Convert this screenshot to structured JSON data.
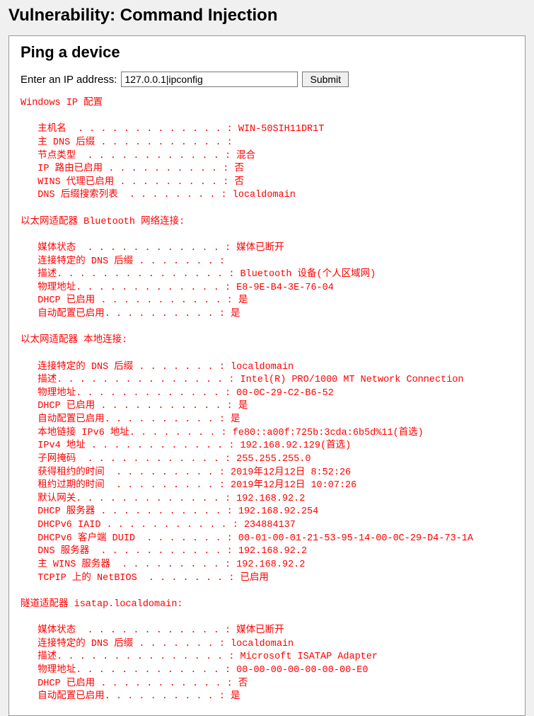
{
  "page": {
    "title": "Vulnerability: Command Injection"
  },
  "panel": {
    "title": "Ping a device",
    "form": {
      "label": "Enter an IP address:",
      "input_value": "127.0.0.1|ipconfig",
      "submit_label": "Submit"
    }
  },
  "output_text": "Windows IP 配置\n\n   主机名  . . . . . . . . . . . . . : WIN-50SIH11DR1T\n   主 DNS 后缀 . . . . . . . . . . . : \n   节点类型  . . . . . . . . . . . . : 混合\n   IP 路由已启用 . . . . . . . . . . : 否\n   WINS 代理已启用 . . . . . . . . . : 否\n   DNS 后缀搜索列表  . . . . . . . . : localdomain\n\n以太网适配器 Bluetooth 网络连接:\n\n   媒体状态  . . . . . . . . . . . . : 媒体已断开\n   连接特定的 DNS 后缀 . . . . . . . : \n   描述. . . . . . . . . . . . . . . : Bluetooth 设备(个人区域网)\n   物理地址. . . . . . . . . . . . . : E8-9E-B4-3E-76-04\n   DHCP 已启用 . . . . . . . . . . . : 是\n   自动配置已启用. . . . . . . . . . : 是\n\n以太网适配器 本地连接:\n\n   连接特定的 DNS 后缀 . . . . . . . : localdomain\n   描述. . . . . . . . . . . . . . . : Intel(R) PRO/1000 MT Network Connection\n   物理地址. . . . . . . . . . . . . : 00-0C-29-C2-B6-52\n   DHCP 已启用 . . . . . . . . . . . : 是\n   自动配置已启用. . . . . . . . . . : 是\n   本地链接 IPv6 地址. . . . . . . . : fe80::a00f:725b:3cda:6b5d%11(首选) \n   IPv4 地址 . . . . . . . . . . . . : 192.168.92.129(首选) \n   子网掩码  . . . . . . . . . . . . : 255.255.255.0\n   获得租约的时间  . . . . . . . . . : 2019年12月12日 8:52:26\n   租约过期的时间  . . . . . . . . . : 2019年12月12日 10:07:26\n   默认网关. . . . . . . . . . . . . : 192.168.92.2\n   DHCP 服务器 . . . . . . . . . . . : 192.168.92.254\n   DHCPv6 IAID . . . . . . . . . . . : 234884137\n   DHCPv6 客户端 DUID  . . . . . . . : 00-01-00-01-21-53-95-14-00-0C-29-D4-73-1A\n   DNS 服务器  . . . . . . . . . . . : 192.168.92.2\n   主 WINS 服务器  . . . . . . . . . : 192.168.92.2\n   TCPIP 上的 NetBIOS  . . . . . . . : 已启用\n\n隧道适配器 isatap.localdomain:\n\n   媒体状态  . . . . . . . . . . . . : 媒体已断开\n   连接特定的 DNS 后缀 . . . . . . . : localdomain\n   描述. . . . . . . . . . . . . . . : Microsoft ISATAP Adapter\n   物理地址. . . . . . . . . . . . . : 00-00-00-00-00-00-00-E0\n   DHCP 已启用 . . . . . . . . . . . : 否\n   自动配置已启用. . . . . . . . . . : 是"
}
